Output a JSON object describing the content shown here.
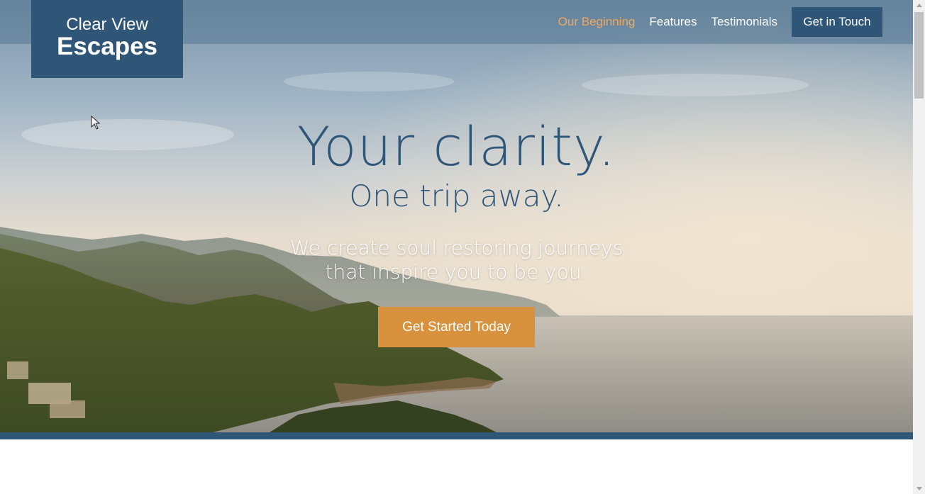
{
  "logo": {
    "line1": "Clear View",
    "line2": "Escapes"
  },
  "nav": {
    "items": [
      {
        "label": "Our Beginning",
        "active": true
      },
      {
        "label": "Features",
        "active": false
      },
      {
        "label": "Testimonials",
        "active": false
      }
    ],
    "cta_label": "Get in Touch"
  },
  "hero": {
    "title": "Your clarity.",
    "subtitle": "One trip away.",
    "tagline_line1": "We create soul restoring journeys",
    "tagline_line2": "that inspire you to be you.",
    "cta_label": "Get Started Today"
  },
  "colors": {
    "primary": "#2f5577",
    "accent": "#d8923e",
    "active_link": "#f0a85c"
  }
}
